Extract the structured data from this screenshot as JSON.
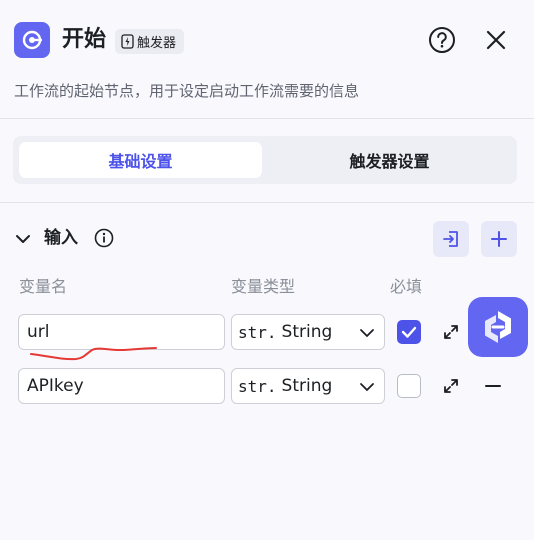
{
  "header": {
    "title": "开始",
    "badge": "触发器",
    "help_icon": "question-circle-icon",
    "close_icon": "close-icon"
  },
  "description": "工作流的起始节点，用于设定启动工作流需要的信息",
  "tabs": [
    {
      "label": "基础设置",
      "active": true
    },
    {
      "label": "触发器设置",
      "active": false
    }
  ],
  "input_section": {
    "title": "输入",
    "columns": {
      "name": "变量名",
      "type": "变量类型",
      "required": "必填"
    },
    "rows": [
      {
        "name": "url",
        "type_prefix": "str.",
        "type": "String",
        "required": true
      },
      {
        "name": "APIkey",
        "type_prefix": "str.",
        "type": "String",
        "required": false
      }
    ]
  },
  "colors": {
    "accent": "#4d53e8",
    "brand": "#6366f1",
    "annotation": "#e53935"
  }
}
